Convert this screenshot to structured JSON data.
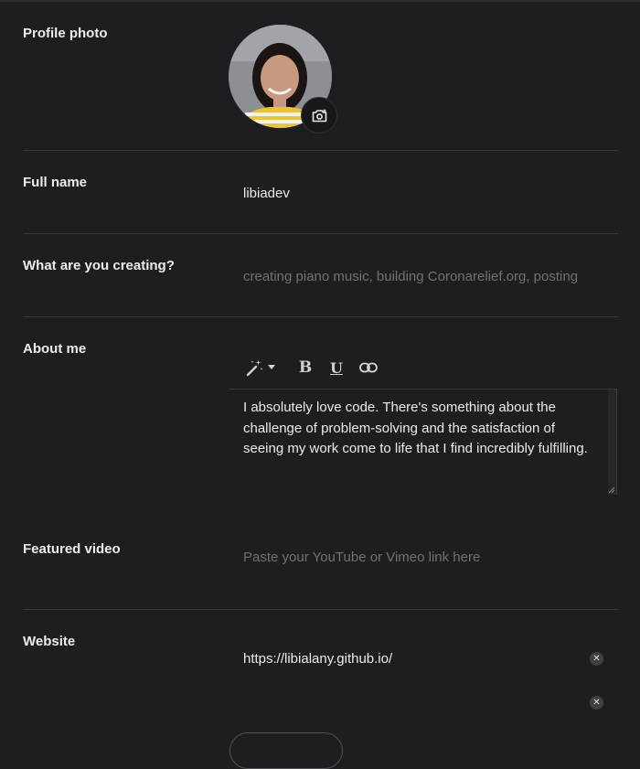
{
  "colors": {
    "background": "#1d1e20",
    "divider": "#3a3b3e",
    "placeholder": "#707176",
    "text": "#ececec"
  },
  "profile_photo": {
    "label": "Profile photo",
    "change_icon": "camera-plus-icon"
  },
  "full_name": {
    "label": "Full name",
    "value": "libiadev"
  },
  "creating": {
    "label": "What are you creating?",
    "placeholder": "creating piano music, building Coronarelief.org, posting"
  },
  "about": {
    "label": "About me",
    "toolbar": {
      "ai_icon": "magic-wand-icon",
      "dropdown_icon": "caret-down-icon",
      "bold_label": "B",
      "underline_label": "U",
      "link_icon": "link-icon"
    },
    "text": "I absolutely love code. There's something about the challenge of problem-solving and the satisfaction of seeing my work come to life that I find incredibly fulfilling."
  },
  "featured_video": {
    "label": "Featured video",
    "placeholder": "Paste your YouTube or Vimeo link here"
  },
  "website": {
    "label": "Website",
    "links": [
      "https://libialany.github.io/",
      ""
    ],
    "clear_icon": "close-icon"
  }
}
